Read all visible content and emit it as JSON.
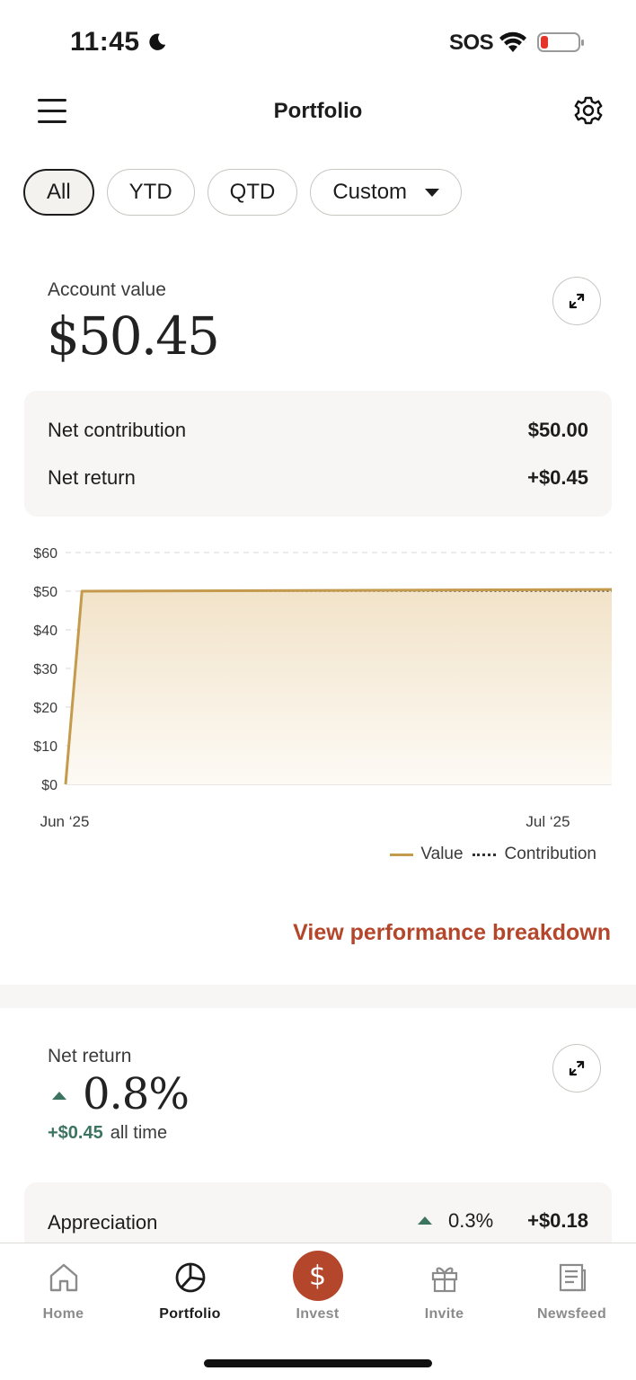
{
  "status_bar": {
    "time": "11:45",
    "sos": "SOS"
  },
  "header": {
    "title": "Portfolio"
  },
  "filters": [
    {
      "label": "All",
      "active": true
    },
    {
      "label": "YTD",
      "active": false
    },
    {
      "label": "QTD",
      "active": false
    },
    {
      "label": "Custom",
      "active": false,
      "dropdown": true
    }
  ],
  "account": {
    "label": "Account value",
    "value": "$50.45"
  },
  "summary": {
    "net_contribution_label": "Net contribution",
    "net_contribution_value": "$50.00",
    "net_return_label": "Net return",
    "net_return_value": "+$0.45"
  },
  "chart_data": {
    "type": "area",
    "x_labels": [
      "Jun ‘25",
      "Jul ‘25"
    ],
    "y_ticks": [
      "$0",
      "$10",
      "$20",
      "$30",
      "$40",
      "$50",
      "$60"
    ],
    "ylim": [
      0,
      60
    ],
    "grid": true,
    "legend_position": "bottom-right",
    "series": [
      {
        "name": "Value",
        "style": "solid",
        "color": "#c49a4c",
        "points": [
          [
            0,
            0
          ],
          [
            0.03,
            50.0
          ],
          [
            0.5,
            50.2
          ],
          [
            1.0,
            50.45
          ]
        ]
      },
      {
        "name": "Contribution",
        "style": "dotted",
        "color": "#333333",
        "points": [
          [
            0,
            0
          ],
          [
            0.03,
            50.0
          ],
          [
            1.0,
            50.0
          ]
        ]
      }
    ]
  },
  "legend": {
    "value": "Value",
    "contribution": "Contribution"
  },
  "breakdown_link": "View performance breakdown",
  "net_return": {
    "label": "Net return",
    "percent": "0.8%",
    "amount": "+$0.45",
    "period": "all time"
  },
  "appreciation": {
    "label": "Appreciation",
    "percent": "0.3%",
    "amount": "+$0.18"
  },
  "tabs": [
    {
      "label": "Home",
      "icon": "home-icon",
      "active": false
    },
    {
      "label": "Portfolio",
      "icon": "pie-chart-icon",
      "active": true
    },
    {
      "label": "Invest",
      "icon": "dollar-icon",
      "active": false
    },
    {
      "label": "Invite",
      "icon": "gift-icon",
      "active": false
    },
    {
      "label": "Newsfeed",
      "icon": "newspaper-icon",
      "active": false
    }
  ],
  "colors": {
    "accent": "#b3462b",
    "gold": "#c49a4c",
    "positive": "#3d7461"
  }
}
